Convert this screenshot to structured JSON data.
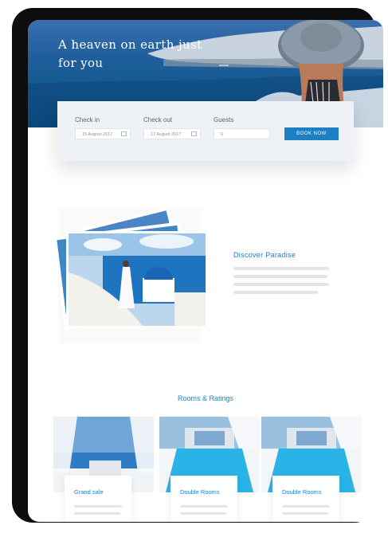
{
  "hero": {
    "title": "A heaven on earth just for you"
  },
  "booking": {
    "checkin_label": "Check in",
    "checkin_value": "15 August 2017",
    "checkout_label": "Check out",
    "checkout_value": "17 August 2017",
    "guests_label": "Guests",
    "guests_value": "6",
    "button_label": "BOOK NOW"
  },
  "discover": {
    "title": "Discover Paradise"
  },
  "rooms": {
    "title": "Rooms & Ratings",
    "items": [
      {
        "name": "Grand sale"
      },
      {
        "name": "Double Rooms"
      },
      {
        "name": "Double Rooms"
      }
    ]
  },
  "colors": {
    "accent": "#1d80c3",
    "device": "#0d0d0d"
  }
}
